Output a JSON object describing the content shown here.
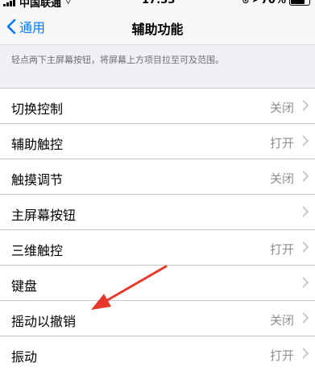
{
  "status_bar": {
    "carrier": "中国联通",
    "time": "17:33",
    "battery": "70%"
  },
  "nav": {
    "back_label": "通用",
    "title": "辅助功能"
  },
  "hint": "轻点两下主屏幕按钮，将屏幕上方项目拉至可及范围。",
  "rows": [
    {
      "label": "切换控制",
      "value": "关闭"
    },
    {
      "label": "辅助触控",
      "value": "打开"
    },
    {
      "label": "触摸调节",
      "value": "关闭"
    },
    {
      "label": "主屏幕按钮",
      "value": ""
    },
    {
      "label": "三维触控",
      "value": "打开"
    },
    {
      "label": "键盘",
      "value": ""
    },
    {
      "label": "摇动以撤销",
      "value": "关闭"
    },
    {
      "label": "振动",
      "value": "打开"
    }
  ],
  "colors": {
    "accent": "#007aff",
    "annotation_arrow": "#e8382b"
  }
}
